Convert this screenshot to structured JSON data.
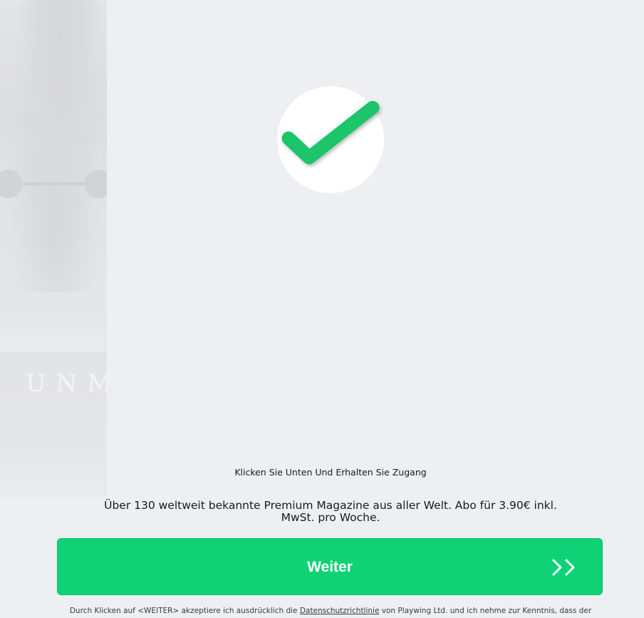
{
  "background": {
    "masthead_fragment": "UNMA"
  },
  "success": {
    "icon": "checkmark-icon",
    "color": "#1ec46a"
  },
  "cta": {
    "access_text": "Klicken Sie Unten Und Erhalten Sie Zugang",
    "offer_text": "Über 130 weltweit bekannte Premium Magazine aus aller Welt. Abo für 3.90€ inkl. MwSt. pro Woche.",
    "button_label": "Weiter",
    "button_icon": "double-chevron-right-icon",
    "button_color": "#0fd276"
  },
  "legal": {
    "before_link": "Durch Klicken auf <WEITER> akzeptiere ich ausdrücklich die ",
    "link_text": "Datenschutzrichtlinie",
    "after_link": " von Playwing Ltd. und ich nehme zur Kenntnis, dass der"
  }
}
